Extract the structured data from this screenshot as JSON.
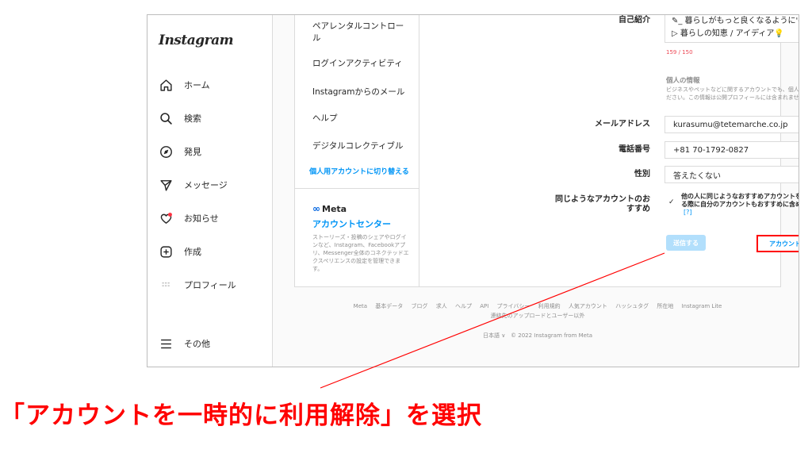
{
  "left_nav": {
    "logo": "Instagram",
    "items": [
      {
        "icon": "home-icon",
        "label": "ホーム"
      },
      {
        "icon": "search-icon",
        "label": "検索"
      },
      {
        "icon": "compass-icon",
        "label": "発見"
      },
      {
        "icon": "paper-plane-icon",
        "label": "メッセージ"
      },
      {
        "icon": "heart-icon",
        "label": "お知らせ"
      },
      {
        "icon": "plus-square-icon",
        "label": "作成"
      },
      {
        "icon": "avatar-icon",
        "label": "プロフィール"
      },
      {
        "icon": "menu-icon",
        "label": "その他"
      }
    ]
  },
  "settings_menu": {
    "items": [
      "ペアレンタルコントロール",
      "ログインアクティビティ",
      "Instagramからのメール",
      "ヘルプ",
      "デジタルコレクティブル"
    ],
    "switch_account": "個人用アカウントに切り替える",
    "meta": {
      "logo": "Meta",
      "title": "アカウントセンター",
      "description": "ストーリーズ・投稿のシェアやログインなど、Instagram、Facebookアプリ、Messenger全体のコネクテッドエクスペリエンスの設定を管理できます。"
    }
  },
  "form": {
    "bio": {
      "label": "自己紹介",
      "line1": "✎_ 暮らしがもっと良くなるように'-",
      "line2": "▷ 暮らしの知恵 / アイディア💡",
      "counter": "159 / 150"
    },
    "personal_info": {
      "heading": "個人の情報",
      "text": "ビジネスやペットなどに関するアカウントでも、個人の情報を入力してください。この情報は公開プロフィールには含まれません。"
    },
    "email": {
      "label": "メールアドレス",
      "value": "kurasumu@tetemarche.co.jp"
    },
    "phone": {
      "label": "電話番号",
      "value": "+81 70-1792-0827"
    },
    "gender": {
      "label": "性別",
      "value": "答えたくない"
    },
    "suggestions": {
      "label": "同じようなアカウントのおすすめ",
      "text": "他の人に同じようなおすすめアカウントを紹介する際に自分のアカウントもおすすめに含める。",
      "help": "[?]",
      "checked": true
    },
    "submit_label": "送信する",
    "deactivate_label": "アカウントを一時的に利用解除"
  },
  "footer": {
    "links": [
      "Meta",
      "基本データ",
      "ブログ",
      "求人",
      "ヘルプ",
      "API",
      "プライバシー",
      "利用規約",
      "人気アカウント",
      "ハッシュタグ",
      "所在地",
      "Instagram Lite"
    ],
    "second_line": "連絡先のアップロードとユーザー以外",
    "language": "日本語",
    "copyright": "© 2022 Instagram from Meta"
  },
  "annotation": {
    "caption": "「アカウントを一時的に利用解除」を選択",
    "color": "#ff0000"
  }
}
